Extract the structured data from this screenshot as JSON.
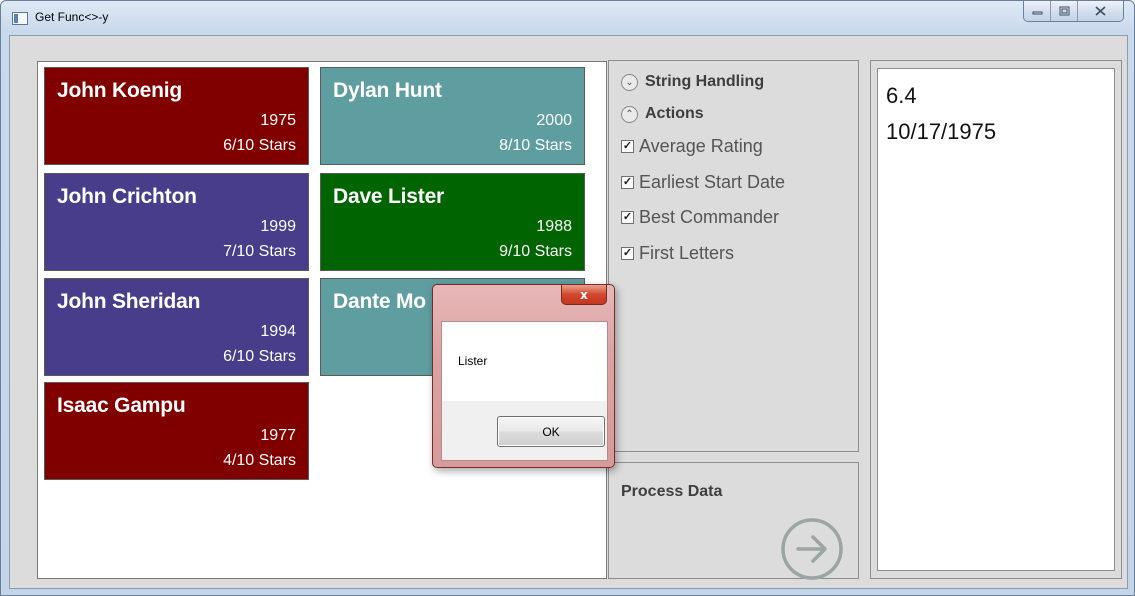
{
  "window": {
    "title": "Get Func<>-y",
    "minimize_icon": "minimize-icon",
    "maximize_icon": "maximize-icon",
    "close_icon": "close-icon"
  },
  "tiles": [
    {
      "name": "John Koenig",
      "year": "1975",
      "stars": "6/10 Stars",
      "color": "#800000"
    },
    {
      "name": "Dylan Hunt",
      "year": "2000",
      "stars": "8/10 Stars",
      "color": "#5f9ea0"
    },
    {
      "name": "John Crichton",
      "year": "1999",
      "stars": "7/10 Stars",
      "color": "#483d8b"
    },
    {
      "name": "Dave Lister",
      "year": "1988",
      "stars": "9/10 Stars",
      "color": "#006400"
    },
    {
      "name": "John Sheridan",
      "year": "1994",
      "stars": "6/10 Stars",
      "color": "#483d8b"
    },
    {
      "name": "Dante Mo",
      "year": "",
      "stars": "",
      "color": "#5f9ea0"
    },
    {
      "name": "Isaac Gampu",
      "year": "1977",
      "stars": "4/10 Stars",
      "color": "#800000"
    }
  ],
  "options": {
    "string_handling": "String Handling",
    "actions": "Actions",
    "checkboxes": [
      {
        "label": "Average Rating",
        "checked": true
      },
      {
        "label": "Earliest Start Date",
        "checked": true
      },
      {
        "label": "Best Commander",
        "checked": true
      },
      {
        "label": "First Letters",
        "checked": true
      }
    ]
  },
  "process": {
    "label": "Process Data",
    "icon": "arrow-right-circle-icon"
  },
  "output": {
    "lines": [
      "6.4",
      "10/17/1975"
    ]
  },
  "dialog": {
    "message": "Lister",
    "ok_label": "OK",
    "close_glyph": "x"
  },
  "colors": {
    "maroon": "#800000",
    "cadet_blue": "#5f9ea0",
    "slate_blue": "#483d8b",
    "green": "#006400",
    "panel_gray": "#dcdcdc"
  }
}
